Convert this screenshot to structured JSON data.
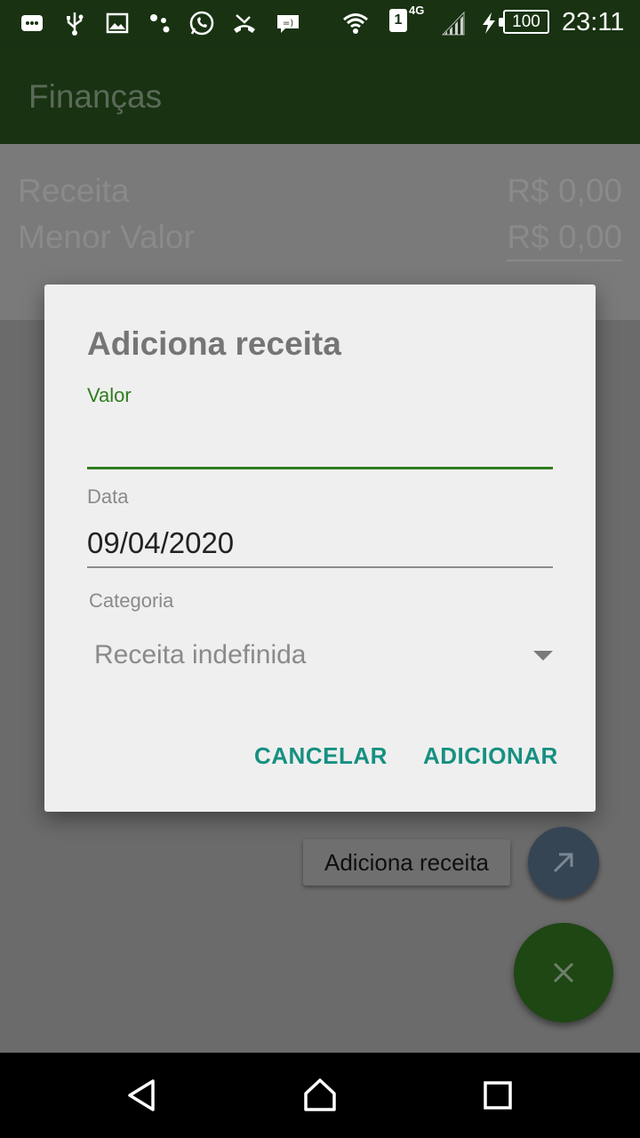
{
  "status_bar": {
    "network_type": "4G",
    "sim_slot": "1",
    "battery": "100",
    "time": "23:11",
    "icons": [
      "message-icon",
      "usb-icon",
      "image-icon",
      "dots-icon",
      "whatsapp-icon",
      "missed-call-icon",
      "chat-icon",
      "wifi-icon",
      "signal-icon",
      "charging-icon"
    ]
  },
  "app_bar": {
    "title": "Finanças"
  },
  "summary": {
    "rows": [
      {
        "label": "Receita",
        "value": "R$ 0,00"
      },
      {
        "label": "Menor Valor",
        "value": "R$ 0,00"
      }
    ]
  },
  "dialog": {
    "title": "Adiciona receita",
    "valor_label": "Valor",
    "valor_value": "",
    "data_label": "Data",
    "data_value": "09/04/2020",
    "categoria_label": "Categoria",
    "categoria_value": "Receita indefinida",
    "cancel_label": "CANCELAR",
    "add_label": "ADICIONAR"
  },
  "speed_dial": {
    "tooltip": "Adiciona receita",
    "mini_fab_icon": "arrow-up-right-icon",
    "main_fab_icon": "close-icon"
  },
  "nav_bar": {
    "icons": [
      "back-icon",
      "home-icon",
      "recents-icon"
    ]
  },
  "colors": {
    "primary_dark": "#183212",
    "accent_teal": "#169081",
    "field_green": "#2e7d1d",
    "fab_green": "#1e4713",
    "mini_fab": "#364554"
  }
}
